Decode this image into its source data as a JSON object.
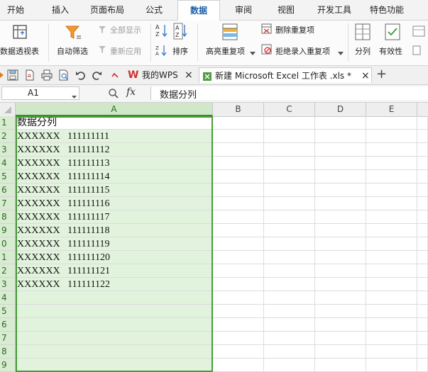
{
  "menu": {
    "tabs": [
      "开始",
      "插入",
      "页面布局",
      "公式",
      "数据",
      "审阅",
      "视图",
      "开发工具",
      "特色功能"
    ],
    "active_index": 4
  },
  "ribbon": {
    "pivot_table": "数据透视表",
    "auto_filter": "自动筛选",
    "show_all": "全部显示",
    "reapply": "重新应用",
    "sort": "排序",
    "highlight_duplicates": "高亮重复项",
    "remove_duplicates": "删除重复项",
    "reject_duplicates": "拒绝录入重复项",
    "split_column": "分列",
    "validation": "有效性"
  },
  "doc_tabs": [
    {
      "label": "我的WPS",
      "close": "×"
    },
    {
      "label": "新建 Microsoft Excel 工作表 .xls *",
      "close": "×"
    }
  ],
  "new_tab": "+",
  "formula_bar": {
    "name_box": "A1",
    "fx": "fx",
    "content": "数据分列"
  },
  "columns": [
    "A",
    "B",
    "C",
    "D",
    "E"
  ],
  "row_numbers": [
    "1",
    "2",
    "3",
    "4",
    "5",
    "6",
    "7",
    "8",
    "9",
    "0",
    "1",
    "2",
    "3",
    "4",
    "5",
    "6",
    "7",
    "8",
    "9"
  ],
  "cells_A": [
    "数据分列",
    "XXXXXX   111111111",
    "XXXXXX   111111112",
    "XXXXXX   111111113",
    "XXXXXX   111111114",
    "XXXXXX   111111115",
    "XXXXXX   111111116",
    "XXXXXX   111111117",
    "XXXXXX   111111118",
    "XXXXXX   111111119",
    "XXXXXX   111111120",
    "XXXXXX   111111121",
    "XXXXXX   111111122"
  ],
  "colors": {
    "selection_border": "#4a9a3b",
    "selection_fill": "#e2f3dd",
    "active_tab_text": "#1a5fa8",
    "wps_logo": "#d0312d"
  }
}
